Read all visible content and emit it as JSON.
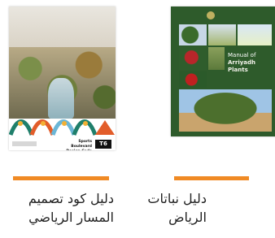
{
  "items": [
    {
      "title": "دليل كود تصميم المسار الرياضي",
      "accent": "#f08a24",
      "cover": {
        "label": "Sports Boulevard Design Code Manual",
        "code": "T6"
      }
    },
    {
      "title": "دليل نباتات الرياض",
      "accent": "#f08a24",
      "cover": {
        "title_line1": "Manual of",
        "title_line2": "Arriyadh Plants"
      }
    }
  ]
}
